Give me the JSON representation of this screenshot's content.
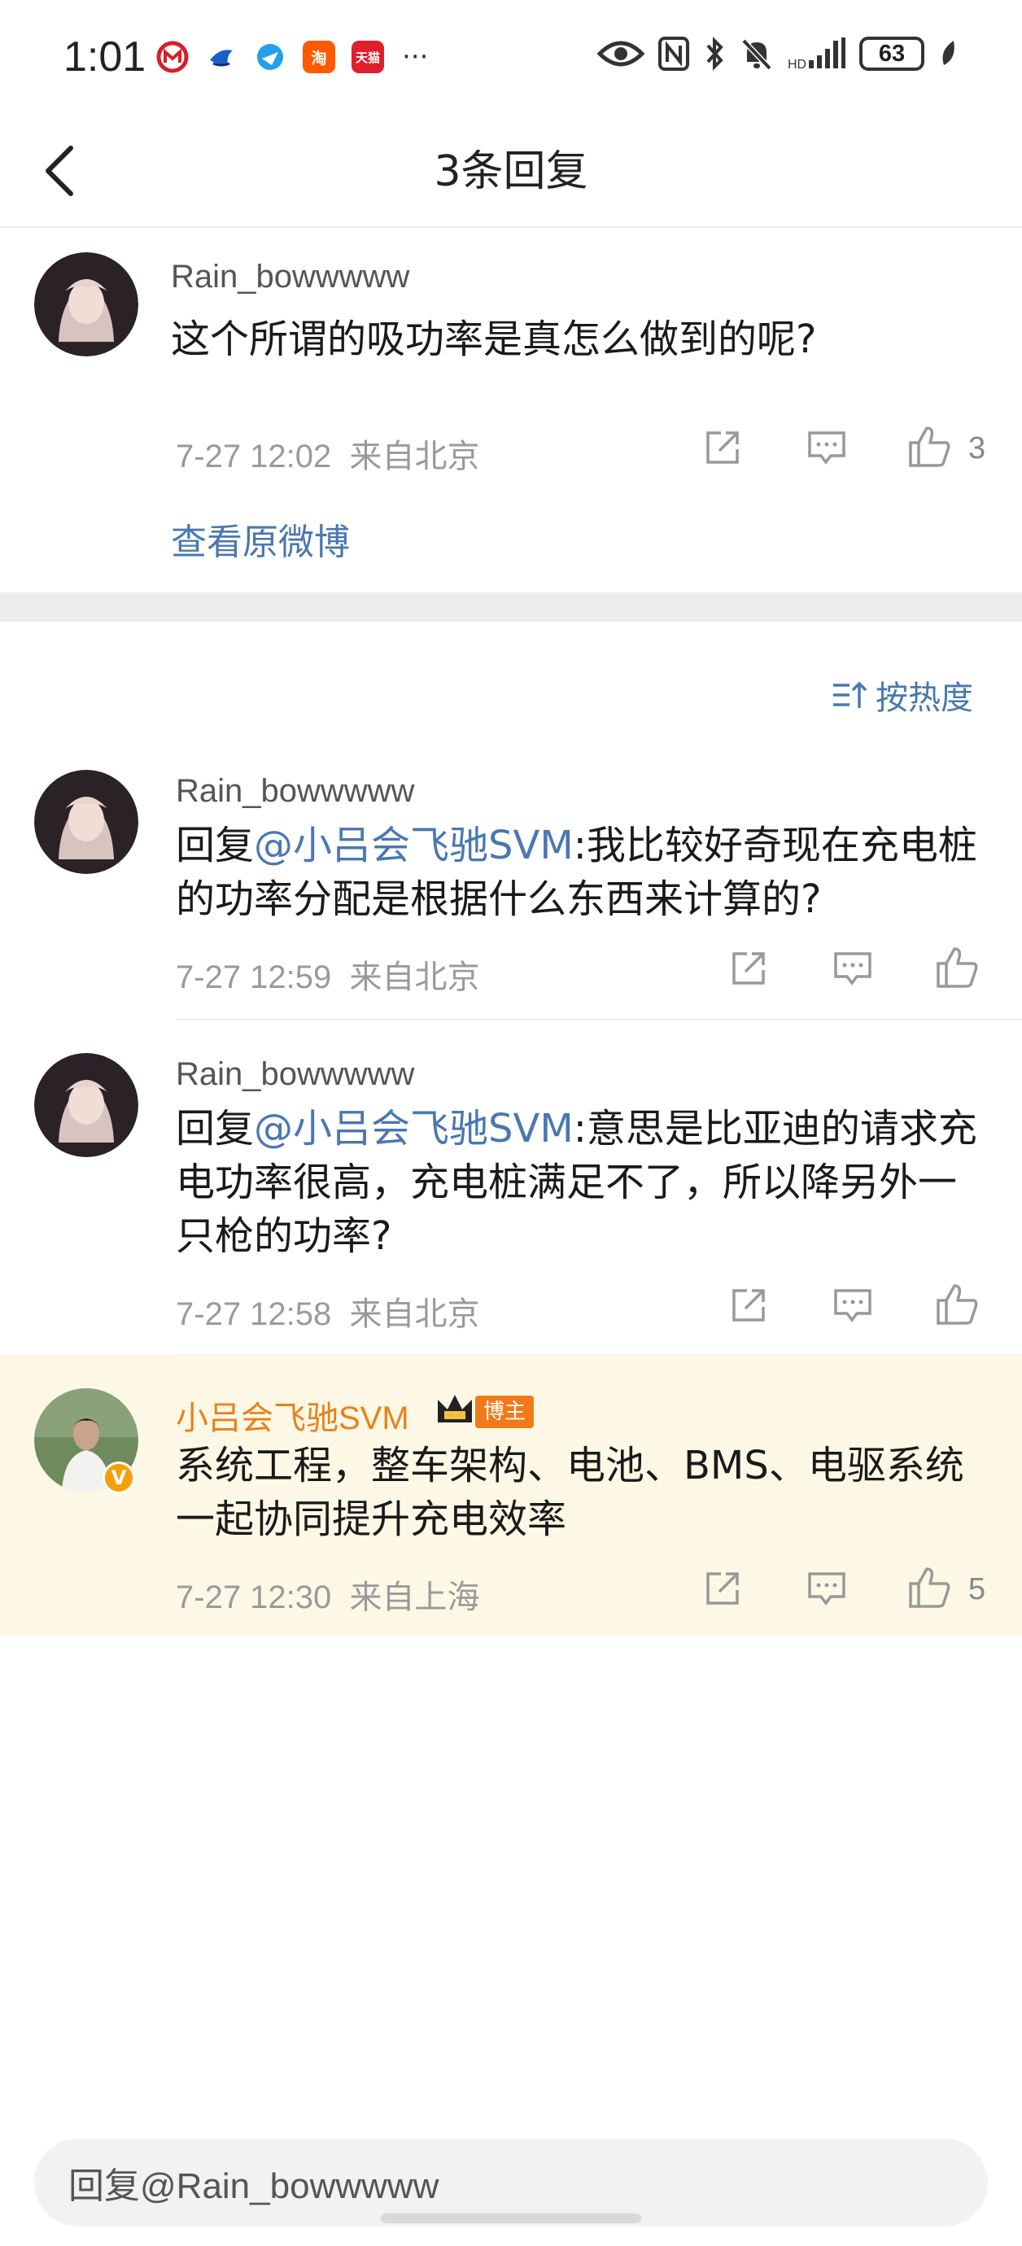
{
  "status_bar": {
    "time": "1:01",
    "apps": [
      {
        "icon": "china-merchants-bank-icon",
        "glyph": "",
        "color": "#d61f2b"
      },
      {
        "icon": "blue-bird-app-icon",
        "glyph": "",
        "color": "#1a5fc8"
      },
      {
        "icon": "browser-icon",
        "glyph": "",
        "color": "#23a0e8"
      },
      {
        "icon": "taobao-icon",
        "glyph": "淘",
        "color": "#ff5a00"
      },
      {
        "icon": "tmall-icon",
        "glyph": "天猫",
        "color": "#e01e2c"
      }
    ],
    "more": "···",
    "battery": "63"
  },
  "header": {
    "title": "3条回复"
  },
  "root_comment": {
    "username": "Rain_bowwwww",
    "text": "这个所谓的吸功率是真怎么做到的呢?",
    "time": "7-27 12:02",
    "location": "来自北京",
    "likes": "3",
    "view_original": "查看原微博"
  },
  "sort": {
    "label": "按热度"
  },
  "replies": [
    {
      "username": "Rain_bowwwww",
      "prefix": "回复",
      "mention": "@小吕会飞驰SVM",
      "text": ":我比较好奇现在充电桩的功率分配是根据什么东西来计算的?",
      "time": "7-27 12:59",
      "location": "来自北京"
    },
    {
      "username": "Rain_bowwwww",
      "prefix": "回复",
      "mention": "@小吕会飞驰SVM",
      "text": ":意思是比亚迪的请求充电功率很高，充电桩满足不了，所以降另外一只枪的功率?",
      "time": "7-27 12:58",
      "location": "来自北京"
    },
    {
      "username": "小吕会飞驰SVM",
      "badge": "博主",
      "verified": "V",
      "text": "系统工程，整车架构、电池、BMS、电驱系统一起协同提升充电效率",
      "time": "7-27 12:30",
      "location": "来自上海",
      "likes": "5"
    }
  ],
  "reply_input": {
    "placeholder": "回复@Rain_bowwwww"
  },
  "colors": {
    "link_blue": "#4a78b0",
    "author_orange": "#e8811a",
    "highlight_bg": "#fdf8e6"
  }
}
